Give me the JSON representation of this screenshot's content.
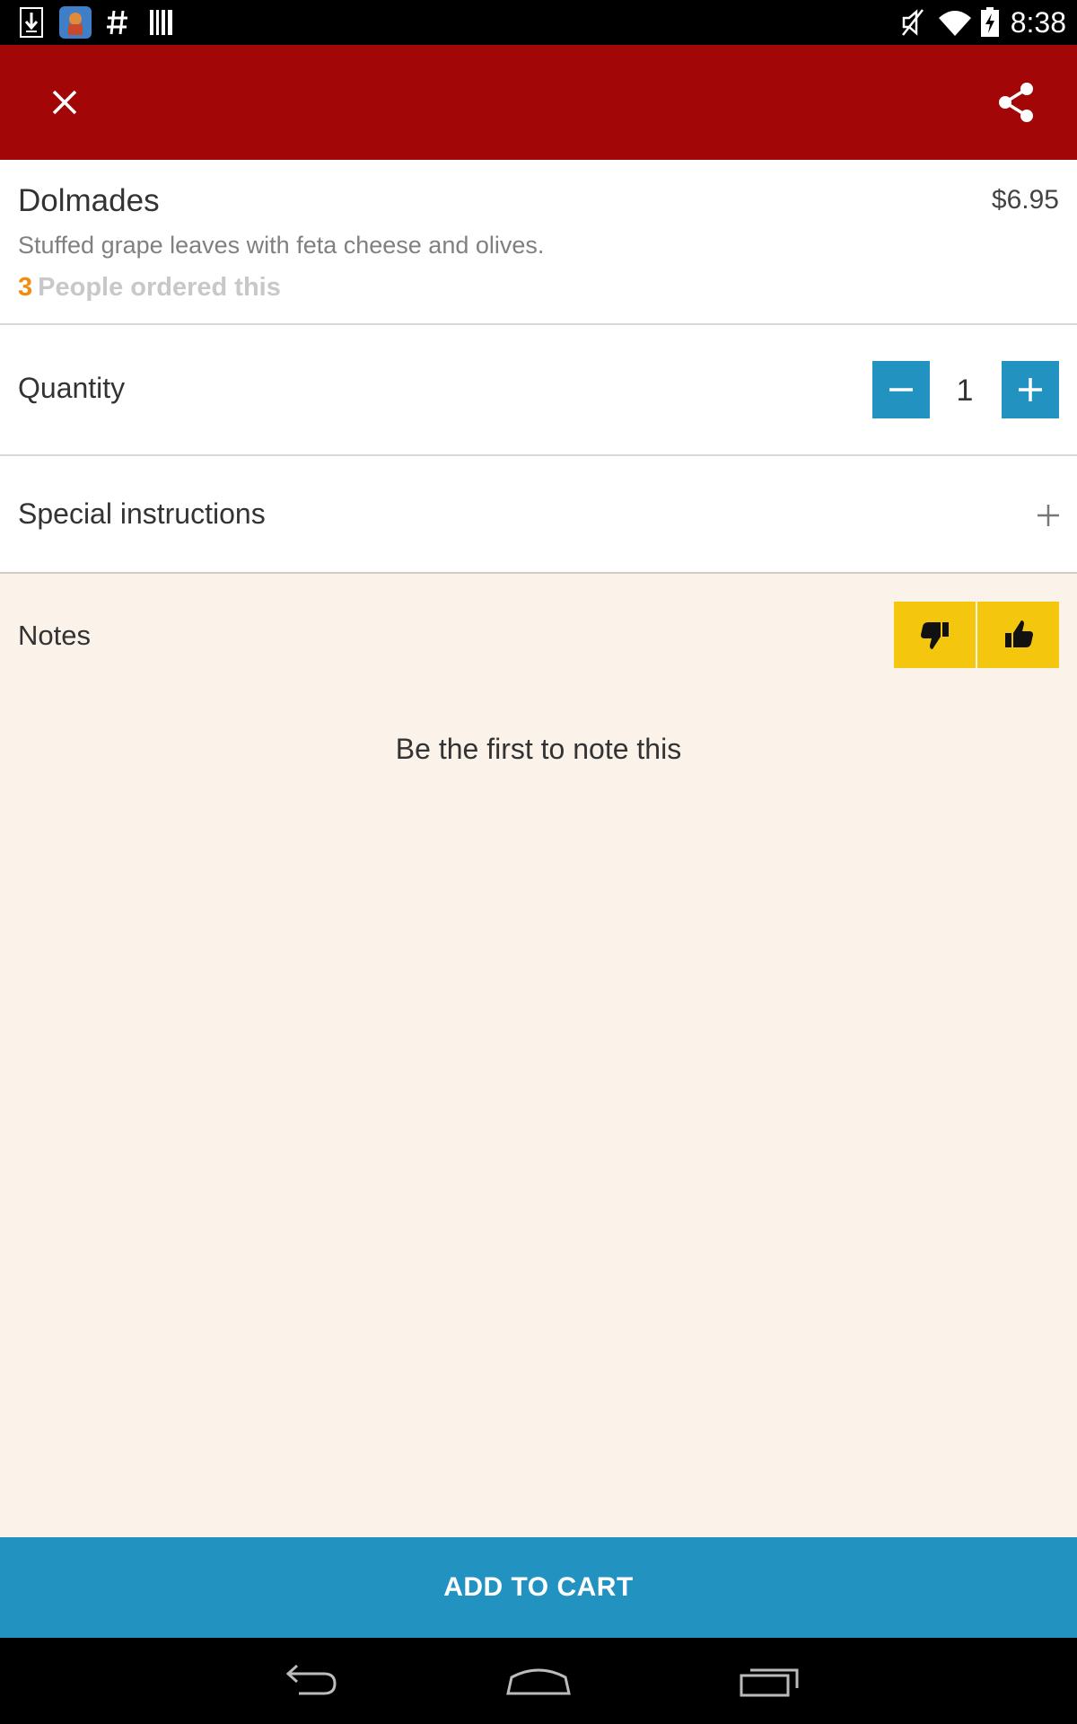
{
  "status_bar": {
    "time": "8:38",
    "left_icons": [
      "download-icon",
      "app-notification-icon",
      "hash-icon",
      "barcode-icon"
    ],
    "right_icons": [
      "mute-icon",
      "wifi-icon",
      "battery-charging-icon"
    ]
  },
  "app_bar": {
    "background": "#a20606",
    "close_icon": "close-icon",
    "share_icon": "share-icon"
  },
  "item": {
    "name": "Dolmades",
    "price": "$6.95",
    "description": "Stuffed grape leaves with feta cheese and olives.",
    "ordered_count": "3",
    "ordered_label": "People ordered this"
  },
  "quantity": {
    "label": "Quantity",
    "value": "1"
  },
  "special_instructions": {
    "label": "Special instructions"
  },
  "notes": {
    "label": "Notes",
    "empty_message": "Be the first to note this"
  },
  "add_to_cart": {
    "label": "ADD TO CART"
  },
  "colors": {
    "accent_blue": "#2292c0",
    "vote_yellow": "#f4c70e",
    "count_orange": "#f28c0f",
    "notes_background": "#fbf2e9"
  }
}
